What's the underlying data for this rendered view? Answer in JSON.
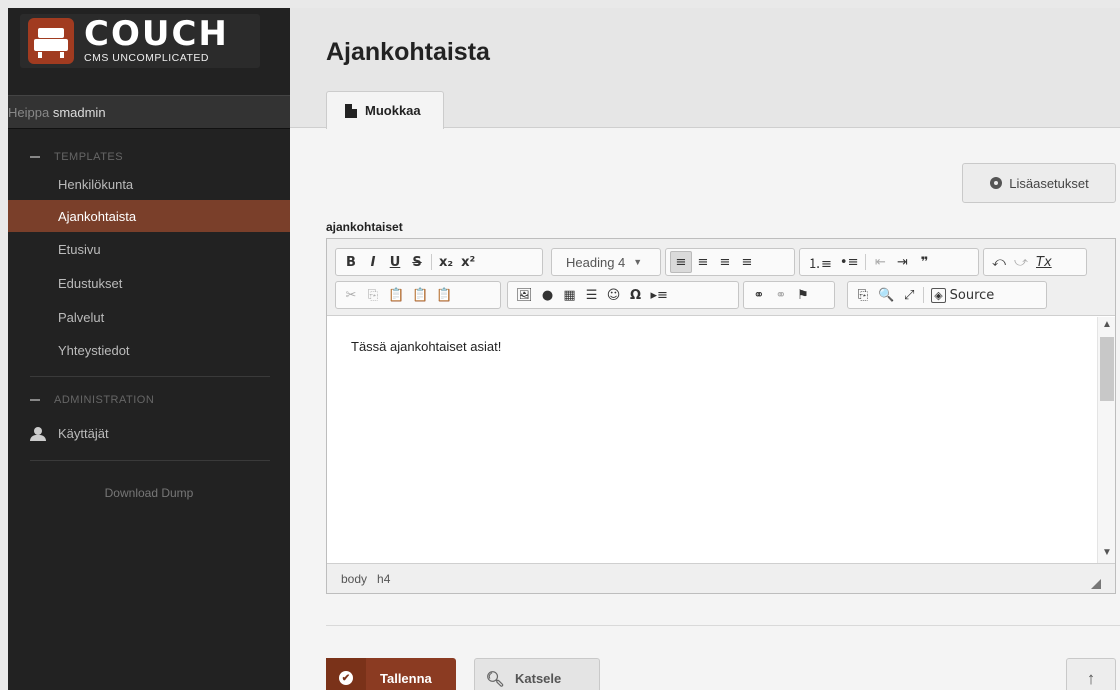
{
  "brand": {
    "title": "COUCH",
    "subtitle": "CMS UNCOMPLICATED"
  },
  "greeting": {
    "prefix": "Heippa ",
    "user": "smadmin"
  },
  "sidebar": {
    "templates_heading": "TEMPLATES",
    "items": [
      {
        "label": "Henkilökunta"
      },
      {
        "label": "Ajankohtaista",
        "active": true
      },
      {
        "label": "Etusivu"
      },
      {
        "label": "Edustukset"
      },
      {
        "label": "Palvelut"
      },
      {
        "label": "Yhteystiedot"
      }
    ],
    "admin_heading": "ADMINISTRATION",
    "admin_item": "Käyttäjät",
    "download": "Download Dump"
  },
  "main": {
    "title": "Ajankohtaista",
    "tab": "Muokkaa",
    "advanced_button": "Lisäasetukset",
    "field_label": "ajankohtaiset"
  },
  "editor": {
    "toolbar_row1": {
      "format": [
        "B",
        "I",
        "U",
        "S",
        "x₂",
        "x²"
      ],
      "heading": "Heading 4",
      "align": [
        "≡",
        "≡",
        "≡",
        "≡"
      ],
      "lists": [
        "⒈≡",
        "•≡",
        "⇤",
        "⇥",
        "❞"
      ],
      "history": [
        "⤺",
        "⤻",
        "Tx"
      ]
    },
    "toolbar_row2": {
      "clipboard": [
        "✂",
        "⎘",
        "📋",
        "📋",
        "📋"
      ],
      "insert": [
        "🖼",
        "●",
        "▦",
        "☰",
        "☺",
        "Ω",
        "▸≡"
      ],
      "links": [
        "⚭",
        "⚭",
        "⚑"
      ],
      "tools": [
        "⎘",
        "🔍",
        "⤢"
      ],
      "source": "Source"
    },
    "content": "Tässä ajankohtaiset asiat!",
    "path": [
      "body",
      "h4"
    ]
  },
  "footer": {
    "save": "Tallenna",
    "view": "Katsele",
    "top": "↑"
  },
  "colors": {
    "accent": "#8b3b22",
    "sidebar_bg": "#222222",
    "active_nav": "#7a3f2a"
  }
}
